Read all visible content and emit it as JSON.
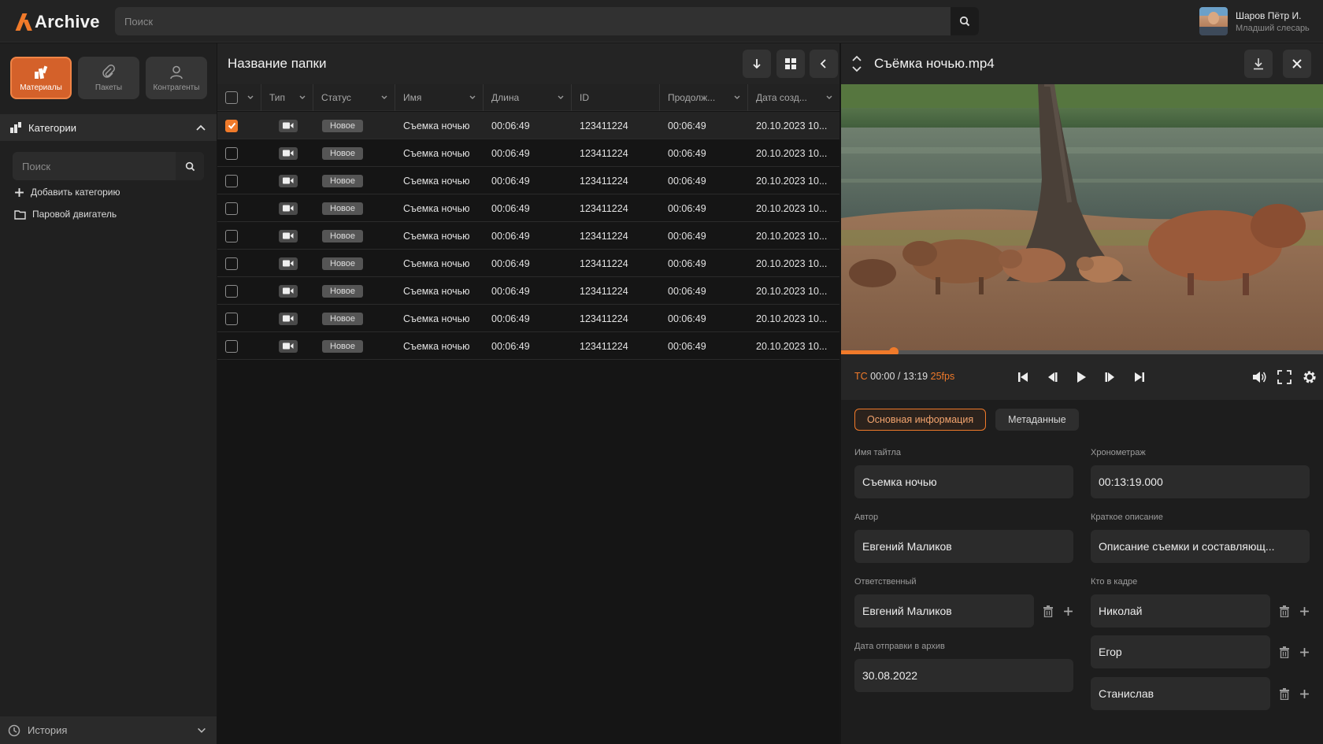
{
  "app": {
    "name": "Archive"
  },
  "search": {
    "placeholder": "Поиск"
  },
  "user": {
    "name": "Шаров Пётр И.",
    "role": "Младший слесарь"
  },
  "sidebar": {
    "tabs": [
      {
        "label": "Материалы",
        "icon": "materials-icon",
        "active": true
      },
      {
        "label": "Пакеты",
        "icon": "paperclip-icon",
        "active": false
      },
      {
        "label": "Контрагенты",
        "icon": "person-icon",
        "active": false
      }
    ],
    "categories_title": "Категории",
    "search_placeholder": "Поиск",
    "add_category": "Добавить категорию",
    "folders": [
      "Паровой двигатель"
    ],
    "history": "История"
  },
  "folder": {
    "title": "Название папки",
    "columns": [
      "Тип",
      "Статус",
      "Имя",
      "Длина",
      "ID",
      "Продолж...",
      "Дата созд..."
    ],
    "rows": [
      {
        "selected": true,
        "status": "Новое",
        "name": "Съемка ночью",
        "length": "00:06:49",
        "id": "123411224",
        "duration": "00:06:49",
        "created": "20.10.2023 10..."
      },
      {
        "selected": false,
        "status": "Новое",
        "name": "Съемка ночью",
        "length": "00:06:49",
        "id": "123411224",
        "duration": "00:06:49",
        "created": "20.10.2023 10..."
      },
      {
        "selected": false,
        "status": "Новое",
        "name": "Съемка ночью",
        "length": "00:06:49",
        "id": "123411224",
        "duration": "00:06:49",
        "created": "20.10.2023 10..."
      },
      {
        "selected": false,
        "status": "Новое",
        "name": "Съемка ночью",
        "length": "00:06:49",
        "id": "123411224",
        "duration": "00:06:49",
        "created": "20.10.2023 10..."
      },
      {
        "selected": false,
        "status": "Новое",
        "name": "Съемка ночью",
        "length": "00:06:49",
        "id": "123411224",
        "duration": "00:06:49",
        "created": "20.10.2023 10..."
      },
      {
        "selected": false,
        "status": "Новое",
        "name": "Съемка ночью",
        "length": "00:06:49",
        "id": "123411224",
        "duration": "00:06:49",
        "created": "20.10.2023 10..."
      },
      {
        "selected": false,
        "status": "Новое",
        "name": "Съемка ночью",
        "length": "00:06:49",
        "id": "123411224",
        "duration": "00:06:49",
        "created": "20.10.2023 10..."
      },
      {
        "selected": false,
        "status": "Новое",
        "name": "Съемка ночью",
        "length": "00:06:49",
        "id": "123411224",
        "duration": "00:06:49",
        "created": "20.10.2023 10..."
      },
      {
        "selected": false,
        "status": "Новое",
        "name": "Съемка ночью",
        "length": "00:06:49",
        "id": "123411224",
        "duration": "00:06:49",
        "created": "20.10.2023 10..."
      }
    ]
  },
  "player": {
    "file_title": "Съёмка ночью.mp4",
    "tc_label": "TC",
    "time": "00:00 / 13:19",
    "fps": "25fps",
    "progress": 0.11
  },
  "details": {
    "tabs": [
      "Основная информация",
      "Метаданные"
    ],
    "active_tab": 0,
    "title_label": "Имя тайтла",
    "title_value": "Съемка ночью",
    "timing_label": "Хронометраж",
    "timing_value": "00:13:19.000",
    "author_label": "Автор",
    "author_value": "Евгений Маликов",
    "desc_label": "Краткое описание",
    "desc_value": "Описание съемки и составляющ...",
    "responsible_label": "Ответственный",
    "responsible_value": "Евгений Маликов",
    "in_frame_label": "Кто в кадре",
    "in_frame": [
      "Николай",
      "Егор",
      "Станислав"
    ],
    "archive_date_label": "Дата отправки в архив",
    "archive_date_value": "30.08.2022"
  },
  "colors": {
    "accent": "#f07a2a",
    "bg": "#161616",
    "panel": "#242424"
  }
}
